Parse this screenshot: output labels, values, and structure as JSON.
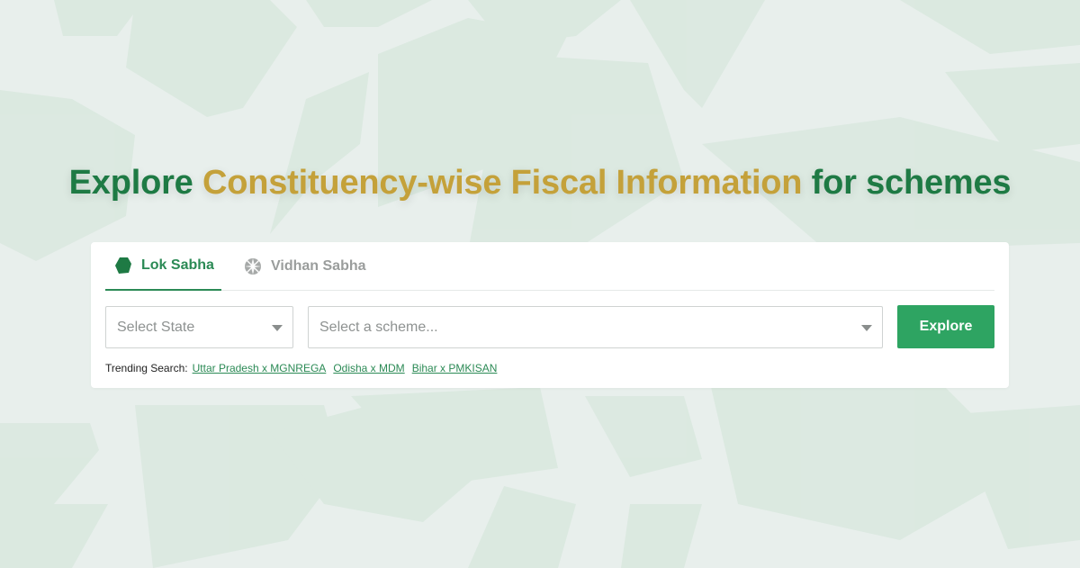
{
  "heading": {
    "part1": "Explore ",
    "part2": "Constituency-wise Fiscal Information",
    "part3": " for schemes"
  },
  "colors": {
    "primary_green": "#2ea462",
    "heading_green": "#1e7a44",
    "heading_gold": "#c4a13a",
    "background": "#e8efec"
  },
  "tabs": [
    {
      "label": "Lok Sabha",
      "icon": "lok-sabha-icon",
      "active": true
    },
    {
      "label": "Vidhan Sabha",
      "icon": "vidhan-sabha-icon",
      "active": false
    }
  ],
  "form": {
    "state_placeholder": "Select State",
    "scheme_placeholder": "Select a scheme...",
    "explore_label": "Explore"
  },
  "trending": {
    "label": "Trending Search:",
    "links": [
      "Uttar Pradesh x MGNREGA",
      "Odisha x MDM",
      "Bihar x PMKISAN"
    ]
  }
}
